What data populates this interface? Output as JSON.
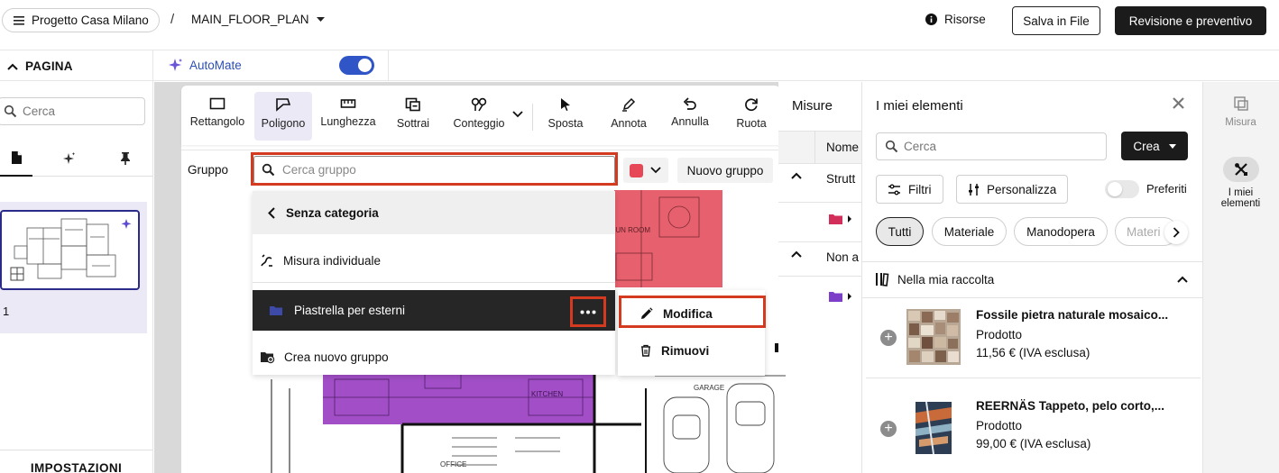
{
  "topbar": {
    "project_name": "Progetto Casa Milano",
    "separator": "/",
    "plan_name": "MAIN_FLOOR_PLAN",
    "resources_label": "Risorse",
    "save_label": "Salva in File",
    "review_label": "Revisione e preventivo"
  },
  "subbar": {
    "page_label": "PAGINA",
    "automate_label": "AutoMate",
    "automate_enabled": true
  },
  "left_panel": {
    "search_placeholder": "Cerca",
    "page_number": "1",
    "settings_label": "IMPOSTAZIONI"
  },
  "toolbar": {
    "tools": [
      {
        "label": "Rettangolo",
        "icon": "rectangle-icon"
      },
      {
        "label": "Poligono",
        "icon": "polygon-icon",
        "active": true
      },
      {
        "label": "Lunghezza",
        "icon": "ruler-icon"
      },
      {
        "label": "Sottrai",
        "icon": "subtract-icon"
      },
      {
        "label": "Conteggio",
        "icon": "count-icon"
      },
      {
        "label": "Sposta",
        "icon": "pointer-icon"
      },
      {
        "label": "Annota",
        "icon": "pen-icon"
      },
      {
        "label": "Annulla",
        "icon": "undo-icon"
      },
      {
        "label": "Ruota",
        "icon": "rotate-icon"
      }
    ]
  },
  "group_bar": {
    "label": "Gruppo",
    "search_placeholder": "Cerca gruppo",
    "color": "#e64858",
    "new_group_label": "Nuovo gruppo"
  },
  "group_dropdown": {
    "back_label": "Senza categoria",
    "items": [
      {
        "label": "Misura individuale",
        "icon": "measure-icon"
      },
      {
        "label": "Piastrella per esterni",
        "icon": "folder-icon",
        "selected": true
      },
      {
        "label": "Crea nuovo gruppo",
        "icon": "folder-plus-icon"
      }
    ]
  },
  "context_menu": {
    "edit_label": "Modifica",
    "remove_label": "Rimuovi"
  },
  "misure_panel": {
    "title": "Misure",
    "column_name": "Nome",
    "rows": [
      "Strutt",
      "Non a"
    ]
  },
  "canvas_labels": {
    "sun_room": "SUN ROOM",
    "kitchen": "KITCHEN",
    "garage": "GARAGE",
    "office": "OFFICE"
  },
  "right_panel": {
    "title": "I miei elementi",
    "search_placeholder": "Cerca",
    "create_label": "Crea",
    "filters_label": "Filtri",
    "customize_label": "Personalizza",
    "favorites_label": "Preferiti",
    "chips": [
      "Tutti",
      "Materiale",
      "Manodopera",
      "Materi"
    ],
    "collection_label": "Nella mia raccolta",
    "products": [
      {
        "name": "Fossile pietra naturale mosaico...",
        "type": "Prodotto",
        "price": "11,56 € (IVA esclusa)"
      },
      {
        "name": "REERNÄS Tappeto, pelo corto,...",
        "type": "Prodotto",
        "price": "99,00 € (IVA esclusa)"
      }
    ]
  },
  "rail": {
    "measure_label": "Misura",
    "my_items_label": "I miei elementi"
  },
  "colors": {
    "accent": "#2f55c6",
    "highlight": "#d43a1f",
    "room_red": "#e6606e",
    "room_purple": "#a24fc7"
  }
}
